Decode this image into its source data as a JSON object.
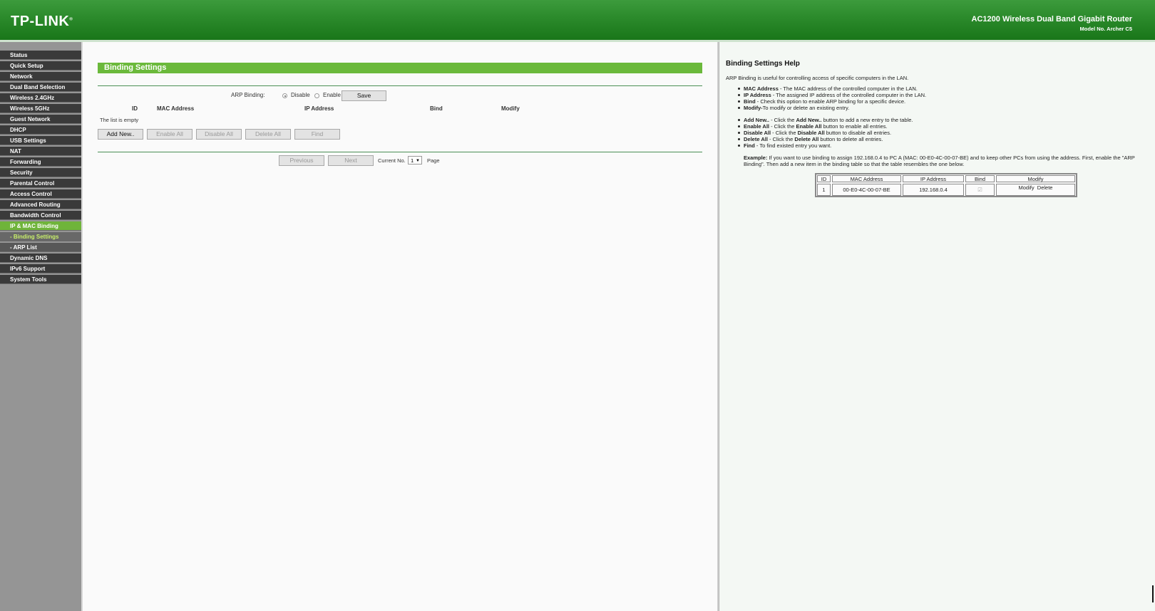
{
  "header": {
    "logo": "TP-LINK",
    "logo_mark": "®",
    "product": "AC1200 Wireless Dual Band Gigabit Router",
    "model": "Model No. Archer C5"
  },
  "sidebar": {
    "items": [
      {
        "label": "Status"
      },
      {
        "label": "Quick Setup"
      },
      {
        "label": "Network"
      },
      {
        "label": "Dual Band Selection"
      },
      {
        "label": "Wireless 2.4GHz"
      },
      {
        "label": "Wireless 5GHz"
      },
      {
        "label": "Guest Network"
      },
      {
        "label": "DHCP"
      },
      {
        "label": "USB Settings"
      },
      {
        "label": "NAT"
      },
      {
        "label": "Forwarding"
      },
      {
        "label": "Security"
      },
      {
        "label": "Parental Control"
      },
      {
        "label": "Access Control"
      },
      {
        "label": "Advanced Routing"
      },
      {
        "label": "Bandwidth Control"
      },
      {
        "label": "IP & MAC Binding",
        "active": true
      },
      {
        "label": "- Binding Settings",
        "sub": true,
        "active": true
      },
      {
        "label": "- ARP List",
        "sub": true
      },
      {
        "label": "Dynamic DNS"
      },
      {
        "label": "IPv6 Support"
      },
      {
        "label": "System Tools"
      }
    ]
  },
  "main": {
    "title": "Binding Settings",
    "arp_binding_label": "ARP Binding:",
    "arp_disable": "Disable",
    "arp_enable": "Enable",
    "arp_selected": "Disable",
    "save": "Save",
    "columns": [
      "ID",
      "MAC Address",
      "IP Address",
      "Bind",
      "Modify"
    ],
    "empty_text": "The list is empty",
    "buttons": {
      "add_new": "Add New..",
      "enable_all": "Enable All",
      "disable_all": "Disable All",
      "delete_all": "Delete All",
      "find": "Find"
    },
    "pager": {
      "previous": "Previous",
      "next": "Next",
      "current_label": "Current No.",
      "current_value": "1",
      "page_label": "Page"
    }
  },
  "help": {
    "title": "Binding Settings Help",
    "intro": "ARP Binding is useful for controlling access of specific computers in the LAN.",
    "terms": [
      {
        "term": "MAC Address",
        "desc": " - The MAC address of the controlled computer in the LAN."
      },
      {
        "term": "IP Address",
        "desc": " - The assigned IP address of the controlled computer in the LAN."
      },
      {
        "term": "Bind",
        "desc": " - Check this option to enable ARP binding for a specific device."
      },
      {
        "term": "Modify-",
        "desc": "To modify or delete an existing entry."
      }
    ],
    "actions": [
      {
        "term": "Add New..",
        "pre": " - Click the ",
        "btn": "Add New..",
        "post": " button to add a new entry to the table."
      },
      {
        "term": "Enable All",
        "pre": " - Click the ",
        "btn": "Enable All",
        "post": " button to enable all entries."
      },
      {
        "term": "Disable All",
        "pre": " - Click the ",
        "btn": "Disable All",
        "post": " button to disable all entries."
      },
      {
        "term": "Delete All",
        "pre": " - Click the ",
        "btn": "Delete All",
        "post": " button to delete all entries."
      },
      {
        "term": "Find",
        "pre": " - To find existed entry you want.",
        "btn": "",
        "post": ""
      }
    ],
    "example_label": "Example:",
    "example_line1": " If you want to use binding to assign 192.168.0.4 to PC A (MAC: 00-E0-4C-00-07-BE) and to keep other PCs from using the address. First, enable the \"ARP",
    "example_line2": "Binding\". Then add a new item in the binding table so that the table resembles the one below.",
    "example_table": {
      "headers": [
        "ID",
        "MAC Address",
        "IP Address",
        "Bind",
        "Modify"
      ],
      "row": {
        "id": "1",
        "mac": "00-E0-4C-00-07-BE",
        "ip": "192.168.0.4",
        "bind_checked": true,
        "modify": "Modify",
        "delete": "Delete"
      }
    }
  },
  "colors": {
    "header_green": "#2b8a2b",
    "accent_green": "#6bb93b",
    "menu_dark": "#3a3a3a",
    "sub_active_text": "#c9f06a"
  }
}
